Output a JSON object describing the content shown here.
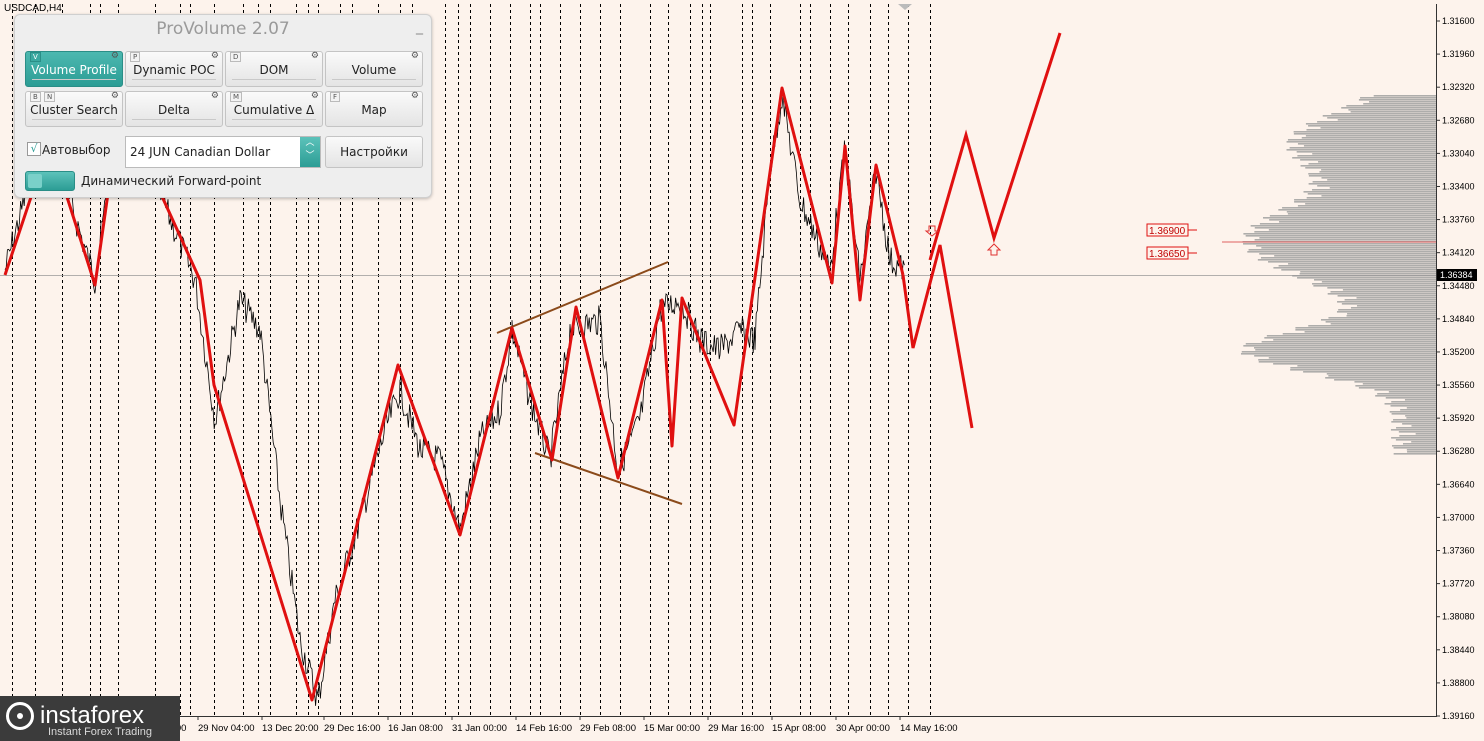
{
  "chart": {
    "symbol": "USDCAD,H4",
    "price_ticks": [
      "1.39160",
      "1.38800",
      "1.38440",
      "1.38080",
      "1.37720",
      "1.37360",
      "1.37000",
      "1.36640",
      "1.36280",
      "1.35920",
      "1.35560",
      "1.35200",
      "1.34840",
      "1.34480",
      "1.34120",
      "1.33760",
      "1.33400",
      "1.33040",
      "1.32680",
      "1.32320",
      "1.31960",
      "1.31600"
    ],
    "current_price": "1.36384",
    "level_labels": [
      "1.36900",
      "1.36650"
    ],
    "time_labels": [
      "29 Nov 04:00",
      "13 Dec 20:00",
      "29 Dec 16:00",
      "16 Jan 08:00",
      "31 Jan 00:00",
      "14 Feb 16:00",
      "29 Feb 08:00",
      "15 Mar 00:00",
      "29 Mar 16:00",
      "15 Apr 08:00",
      "30 Apr 00:00",
      "14 May 16:00"
    ],
    "partial_time_labels": [
      "ov 12:00"
    ],
    "colors": {
      "background": "#fdf3ec",
      "zigzag": "#e01010",
      "channel": "#8b4a1a",
      "candles": "#000000",
      "profile": "#a0a0a0",
      "arrows": "#e03030",
      "poc_line": "#e06060"
    }
  },
  "panel": {
    "title": "ProVolume 2.07",
    "minimize": "_",
    "tools": [
      {
        "key": "V",
        "label": "Volume Profile",
        "active": true
      },
      {
        "key": "P",
        "label": "Dynamic POC",
        "active": false
      },
      {
        "key": "D",
        "label": "DOM",
        "active": false
      },
      {
        "key": "",
        "label": "Volume",
        "active": false
      },
      {
        "key": "B",
        "key2": "N",
        "label": "Cluster Search",
        "active": false
      },
      {
        "key": "",
        "label": "Delta",
        "active": false
      },
      {
        "key": "M",
        "label": "Cumulative Δ",
        "active": false
      },
      {
        "key": "F",
        "label": "Map",
        "active": false
      }
    ],
    "autoselect_label": "Автовыбор",
    "autoselect_checked": "√",
    "instrument": "24 JUN Canadian Dollar",
    "settings_label": "Настройки",
    "forward_label": "Динамический Forward-point"
  },
  "watermark": {
    "name": "instaforex",
    "tagline": "Instant Forex Trading"
  }
}
